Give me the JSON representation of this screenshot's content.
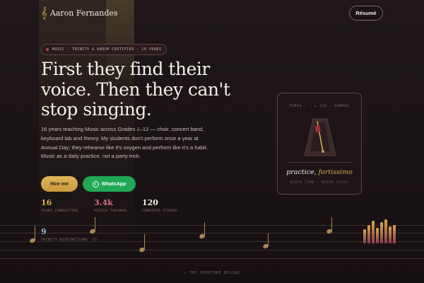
{
  "header": {
    "brand_name": "Aaron Fernandes",
    "brand_icon": "treble-clef-icon",
    "resume_label": "Résumé"
  },
  "hero": {
    "badge_text": "MUSIC · TRINITY & ABRSM CERTIFIED · 16 YEARS",
    "headline_line1": "First they find their",
    "headline_line2": "voice. Then they can't",
    "headline_line3": "stop singing.",
    "lede": "16 years teaching Music across Grades 1–12 — choir, concert band, keyboard lab and theory. My students don't perform once a year at Annual Day; they rehearse like it's oxygen and perform like it's a habit. Music as a daily practice, not a party trick.",
    "hire_label": "Hire me",
    "whatsapp_label": "WhatsApp",
    "whatsapp_icon": "whatsapp-icon"
  },
  "stats": [
    {
      "value": "16",
      "label": "YEARS CONDUCTING",
      "color": "#d9a84a"
    },
    {
      "value": "3.4k",
      "label": "VOICES TRAINED",
      "color": "#d7708a"
    },
    {
      "value": "120",
      "label": "CONCERTS STAGED",
      "color": "#f2ece6"
    },
    {
      "value": "9",
      "label": "TRINITY DISTINCTIONS '25",
      "color": "#9fb6c4"
    }
  ],
  "card": {
    "tempo_text": "TEMPO · ♩ = 120 · SEMPRE",
    "phrase_plain": "practice,",
    "phrase_accent": "fortissimo",
    "foot_text": "KEEPS TIME · KEEPS FAITH",
    "icon": "metronome-icon"
  },
  "footer": {
    "text": "↓ THE OVERTURE BEGINS"
  },
  "colors": {
    "accent_gold": "#d9a84a",
    "accent_rose": "#d7708a",
    "whatsapp_green": "#1fa855",
    "background": "#1a1315"
  }
}
